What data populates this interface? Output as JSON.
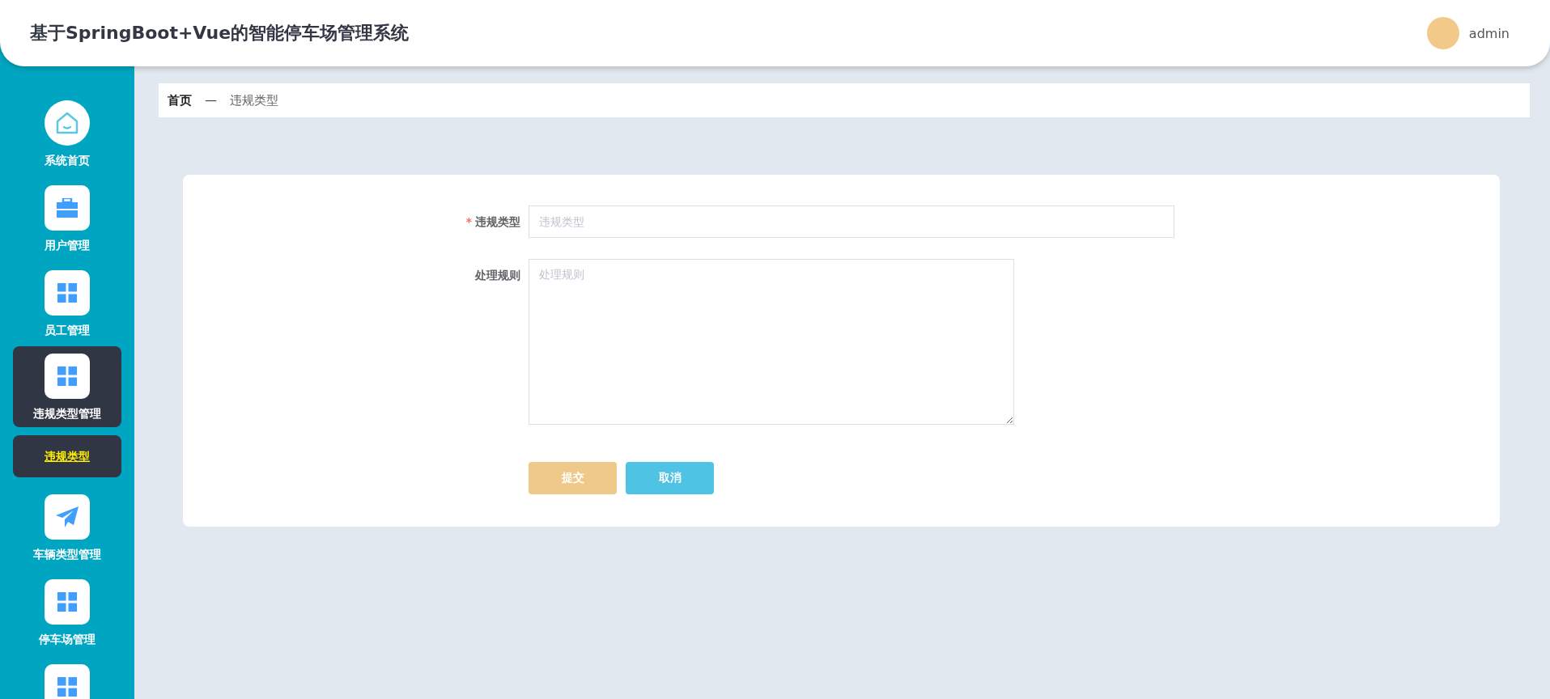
{
  "header": {
    "title": "基于SpringBoot+Vue的智能停车场管理系统",
    "user": "admin"
  },
  "sidebar": {
    "items": [
      {
        "label": "系统首页",
        "expanded": false
      },
      {
        "label": "用户管理",
        "expanded": false
      },
      {
        "label": "员工管理",
        "expanded": false
      },
      {
        "label": "违规类型管理",
        "expanded": true,
        "children": [
          {
            "label": "违规类型",
            "selected": true
          }
        ]
      },
      {
        "label": "车辆类型管理",
        "expanded": false
      },
      {
        "label": "停车场管理",
        "expanded": false
      },
      {
        "expanded": false
      }
    ]
  },
  "breadcrumb": [
    "首页",
    "—",
    "违规类型"
  ],
  "form": {
    "fields": [
      {
        "kind": "input",
        "required_mark": "*",
        "label": "违规类型",
        "placeholder": "违规类型"
      },
      {
        "kind": "textarea",
        "label": "处理规则",
        "placeholder": "处理规则"
      }
    ],
    "buttons": [
      {
        "kind": "submit",
        "label": "提交"
      },
      {
        "kind": "cancel",
        "label": "取消"
      }
    ]
  }
}
